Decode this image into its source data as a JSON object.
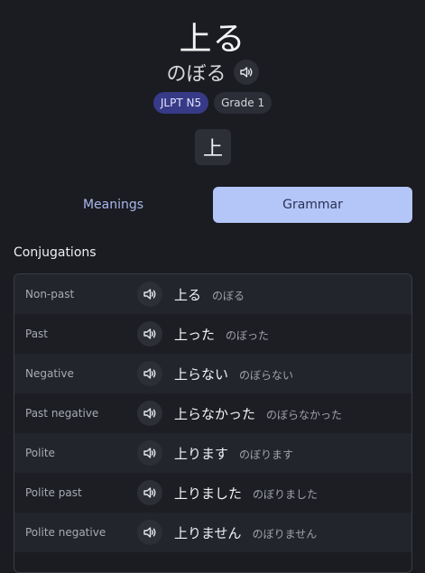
{
  "entry": {
    "word": "上る",
    "reading": "のぼる",
    "badges": {
      "jlpt": "JLPT N5",
      "grade": "Grade 1"
    },
    "kanji": "上"
  },
  "tabs": {
    "meanings": "Meanings",
    "grammar": "Grammar",
    "active": "grammar"
  },
  "conjugations": {
    "title": "Conjugations",
    "rows": [
      {
        "label": "Non-past",
        "kanji": "上る",
        "kana": "のぼる"
      },
      {
        "label": "Past",
        "kanji": "上った",
        "kana": "のぼった"
      },
      {
        "label": "Negative",
        "kanji": "上らない",
        "kana": "のぼらない"
      },
      {
        "label": "Past negative",
        "kanji": "上らなかった",
        "kana": "のぼらなかった"
      },
      {
        "label": "Polite",
        "kanji": "上ります",
        "kana": "のぼります"
      },
      {
        "label": "Polite past",
        "kanji": "上りました",
        "kana": "のぼりました"
      },
      {
        "label": "Polite negative",
        "kanji": "上りません",
        "kana": "のぼりません"
      }
    ]
  },
  "icons": {
    "audio": "speaker-icon"
  },
  "colors": {
    "background": "#1b1c21",
    "accent": "#b4c5f8",
    "jlpt_badge": "#373a86"
  }
}
